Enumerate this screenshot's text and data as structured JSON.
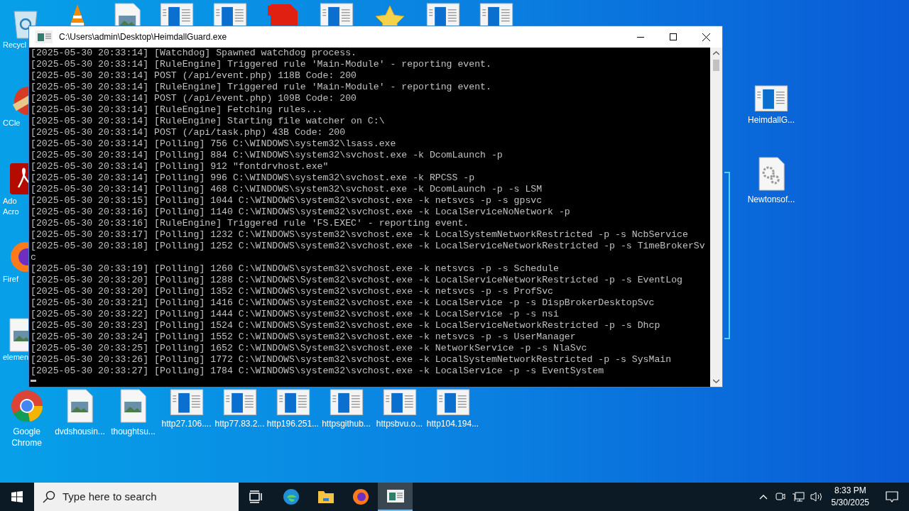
{
  "desktop_icons_left": [
    {
      "label": "Recycl",
      "kind": "recycle"
    },
    {
      "label": "CCle",
      "kind": "ccleaner"
    },
    {
      "label": "Ado\nAcro",
      "kind": "acrobat"
    },
    {
      "label": "Firef",
      "kind": "firefox"
    },
    {
      "label": "elemen",
      "kind": "image"
    }
  ],
  "desktop_icons_top": [
    {
      "kind": "vlc"
    },
    {
      "kind": "image"
    },
    {
      "kind": "window"
    },
    {
      "kind": "window"
    },
    {
      "kind": "pdf"
    },
    {
      "kind": "window"
    },
    {
      "kind": "star"
    },
    {
      "kind": "window"
    },
    {
      "kind": "window"
    }
  ],
  "desktop_icons_bottom": [
    {
      "label": "Google Chrome",
      "kind": "chrome"
    },
    {
      "label": "dvdshousin...",
      "kind": "image"
    },
    {
      "label": "thoughtsu...",
      "kind": "image"
    },
    {
      "label": "http27.106....",
      "kind": "window"
    },
    {
      "label": "http77.83.2...",
      "kind": "window"
    },
    {
      "label": "http196.251...",
      "kind": "window"
    },
    {
      "label": "httpsgithub...",
      "kind": "window"
    },
    {
      "label": "httpsbvu.o...",
      "kind": "window"
    },
    {
      "label": "http104.194...",
      "kind": "window"
    }
  ],
  "desktop_icons_right": [
    {
      "label": "HeimdallG...",
      "kind": "window"
    },
    {
      "label": "Newtonsof...",
      "kind": "gear"
    }
  ],
  "window": {
    "title": "C:\\Users\\admin\\Desktop\\HeimdallGuard.exe",
    "lines": [
      "[2025-05-30 20:33:14] [Watchdog] Spawned watchdog process.",
      "[2025-05-30 20:33:14] [RuleEngine] Triggered rule 'Main-Module' - reporting event.",
      "[2025-05-30 20:33:14] POST (/api/event.php) 118B Code: 200",
      "[2025-05-30 20:33:14] [RuleEngine] Triggered rule 'Main-Module' - reporting event.",
      "[2025-05-30 20:33:14] POST (/api/event.php) 109B Code: 200",
      "[2025-05-30 20:33:14] [RuleEngine] Fetching rules...",
      "[2025-05-30 20:33:14] [RuleEngine] Starting file watcher on C:\\",
      "[2025-05-30 20:33:14] POST (/api/task.php) 43B Code: 200",
      "[2025-05-30 20:33:14] [Polling] 756 C:\\WINDOWS\\system32\\lsass.exe",
      "[2025-05-30 20:33:14] [Polling] 884 C:\\WINDOWS\\system32\\svchost.exe -k DcomLaunch -p",
      "[2025-05-30 20:33:14] [Polling] 912 \"fontdrvhost.exe\"",
      "[2025-05-30 20:33:14] [Polling] 996 C:\\WINDOWS\\system32\\svchost.exe -k RPCSS -p",
      "[2025-05-30 20:33:14] [Polling] 468 C:\\WINDOWS\\system32\\svchost.exe -k DcomLaunch -p -s LSM",
      "[2025-05-30 20:33:15] [Polling] 1044 C:\\WINDOWS\\system32\\svchost.exe -k netsvcs -p -s gpsvc",
      "[2025-05-30 20:33:16] [Polling] 1140 C:\\WINDOWS\\system32\\svchost.exe -k LocalServiceNoNetwork -p",
      "[2025-05-30 20:33:16] [RuleEngine] Triggered rule 'FS.EXEC' - reporting event.",
      "[2025-05-30 20:33:17] [Polling] 1232 C:\\WINDOWS\\system32\\svchost.exe -k LocalSystemNetworkRestricted -p -s NcbService",
      "[2025-05-30 20:33:18] [Polling] 1252 C:\\WINDOWS\\system32\\svchost.exe -k LocalServiceNetworkRestricted -p -s TimeBrokerSv",
      "c",
      "[2025-05-30 20:33:19] [Polling] 1260 C:\\WINDOWS\\system32\\svchost.exe -k netsvcs -p -s Schedule",
      "[2025-05-30 20:33:20] [Polling] 1288 C:\\WINDOWS\\System32\\svchost.exe -k LocalServiceNetworkRestricted -p -s EventLog",
      "[2025-05-30 20:33:20] [Polling] 1352 C:\\WINDOWS\\system32\\svchost.exe -k netsvcs -p -s ProfSvc",
      "[2025-05-30 20:33:21] [Polling] 1416 C:\\WINDOWS\\system32\\svchost.exe -k LocalService -p -s DispBrokerDesktopSvc",
      "[2025-05-30 20:33:22] [Polling] 1444 C:\\WINDOWS\\system32\\svchost.exe -k LocalService -p -s nsi",
      "[2025-05-30 20:33:23] [Polling] 1524 C:\\WINDOWS\\System32\\svchost.exe -k LocalServiceNetworkRestricted -p -s Dhcp",
      "[2025-05-30 20:33:24] [Polling] 1552 C:\\WINDOWS\\system32\\svchost.exe -k netsvcs -p -s UserManager",
      "[2025-05-30 20:33:25] [Polling] 1652 C:\\WINDOWS\\System32\\svchost.exe -k NetworkService -p -s NlaSvc",
      "[2025-05-30 20:33:26] [Polling] 1772 C:\\WINDOWS\\system32\\svchost.exe -k LocalSystemNetworkRestricted -p -s SysMain",
      "[2025-05-30 20:33:27] [Polling] 1784 C:\\WINDOWS\\system32\\svchost.exe -k LocalService -p -s EventSystem"
    ]
  },
  "taskbar": {
    "search_placeholder": "Type here to search",
    "apps": [
      {
        "kind": "taskview",
        "selected": false
      },
      {
        "kind": "edge",
        "selected": false
      },
      {
        "kind": "explorer",
        "selected": false
      },
      {
        "kind": "firefox",
        "selected": false
      },
      {
        "kind": "console",
        "selected": true
      }
    ],
    "time": "8:33 PM",
    "date": "5/30/2025"
  }
}
